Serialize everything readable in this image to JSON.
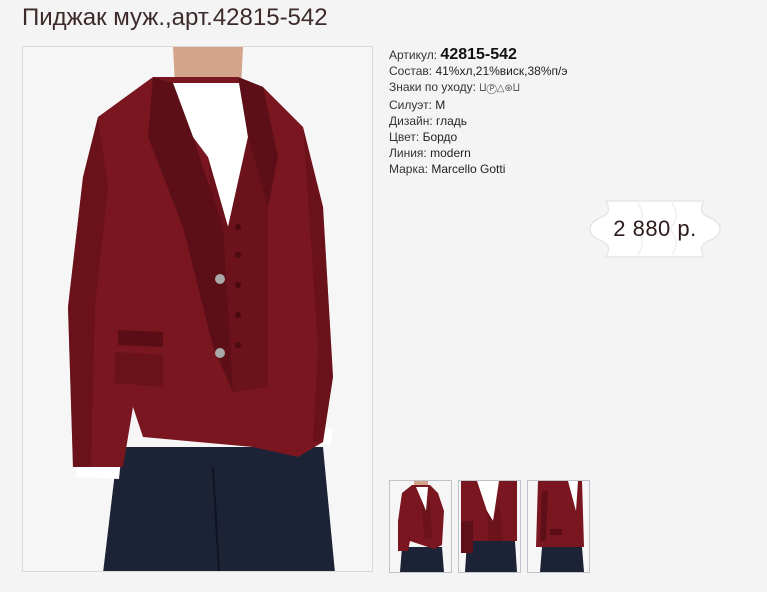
{
  "product": {
    "title": "Пиджак муж.,арт.42815-542",
    "sku_label": "Артикул:",
    "sku_value": "42815-542",
    "composition_label": "Состав:",
    "composition_value": "41%хл,21%виск,38%п/э",
    "care_label": "Знаки по уходу:",
    "care_icons": "⨿Ⓟ△⊛⨿",
    "fit_label": "Силуэт:",
    "fit_value": "M",
    "design_label": "Дизайн:",
    "design_value": "гладь",
    "color_label": "Цвет:",
    "color_value": "Бордо",
    "line_label": "Линия:",
    "line_value": "modern",
    "brand_label": "Марка:",
    "brand_value": "Marcello Gotti",
    "price": "2 880 р."
  },
  "colors": {
    "jacket": "#7a1620",
    "jacket_dark": "#4e0c13",
    "shirt": "#ffffff",
    "jeans": "#1d2336",
    "skin": "#d4a48a"
  },
  "thumbnails": [
    {
      "view": "front"
    },
    {
      "view": "closeup"
    },
    {
      "view": "side"
    }
  ]
}
